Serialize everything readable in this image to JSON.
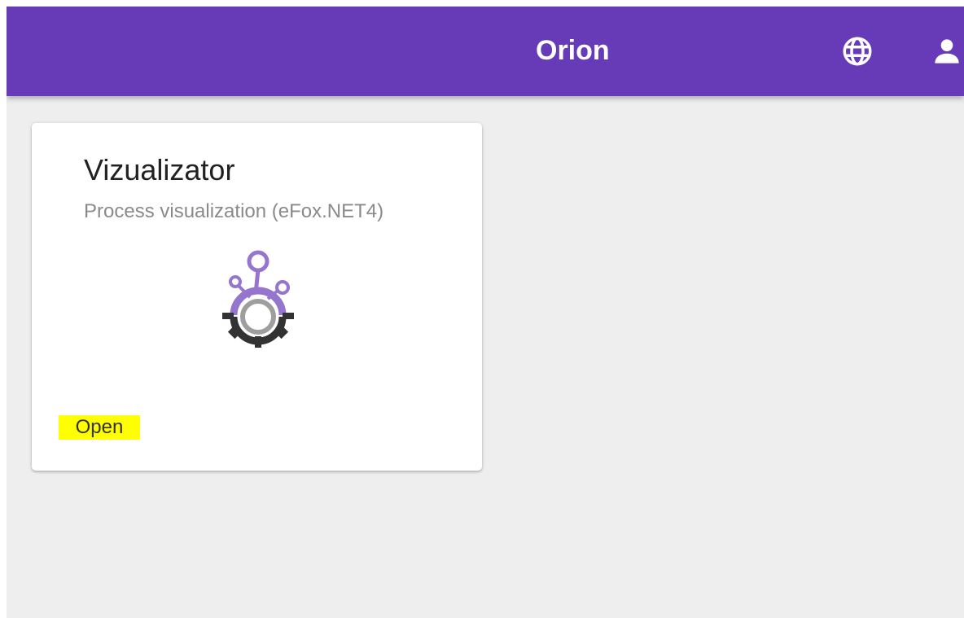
{
  "app": {
    "title": "Orion"
  },
  "toolbar": {
    "language_icon": "globe-icon",
    "account_icon": "person-icon"
  },
  "apps": [
    {
      "title": "Vizualizator",
      "subtitle": "Process visualization (eFox.NET4)",
      "icon": "gear-network-icon",
      "open_label": "Open"
    }
  ],
  "colors": {
    "toolbar": "#673ab7",
    "background": "#eeeeee",
    "card": "#ffffff",
    "accent_purple": "#9575cd",
    "gear_dark": "#333333",
    "highlight": "#ffff00"
  }
}
